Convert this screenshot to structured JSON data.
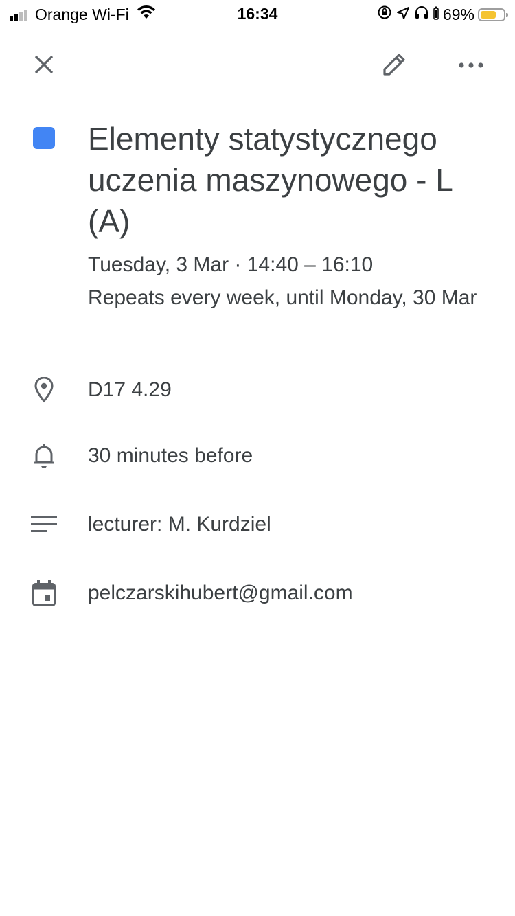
{
  "status_bar": {
    "carrier": "Orange Wi-Fi",
    "time": "16:34",
    "battery_percent": "69%",
    "battery_level": 0.69,
    "battery_color": "#f5c431",
    "signal_bars_active": 2,
    "signal_bars_total": 4,
    "icons": [
      "wifi-icon",
      "orientation-lock-icon",
      "location-icon",
      "headphones-icon",
      "battery-icon"
    ]
  },
  "toolbar": {
    "close_icon": "close-icon",
    "edit_icon": "pencil-icon",
    "more_icon": "more-horizontal-icon"
  },
  "event": {
    "color": "#4285f4",
    "title": "Elementy statystycznego uczenia maszynowego - L (A)",
    "date_time": "Tuesday, 3 Mar · 14:40 – 16:10",
    "recurrence": "Repeats every week, until Monday, 30 Mar"
  },
  "details": {
    "location": {
      "icon": "location-pin-icon",
      "text": "D17 4.29"
    },
    "reminder": {
      "icon": "bell-icon",
      "text": "30 minutes before"
    },
    "description": {
      "icon": "notes-icon",
      "text": "lecturer: M. Kurdziel"
    },
    "calendar": {
      "icon": "calendar-icon",
      "text": "pelczarskihubert@gmail.com"
    }
  },
  "colors": {
    "text_primary": "#3c4043",
    "icon_gray": "#5f6368"
  }
}
